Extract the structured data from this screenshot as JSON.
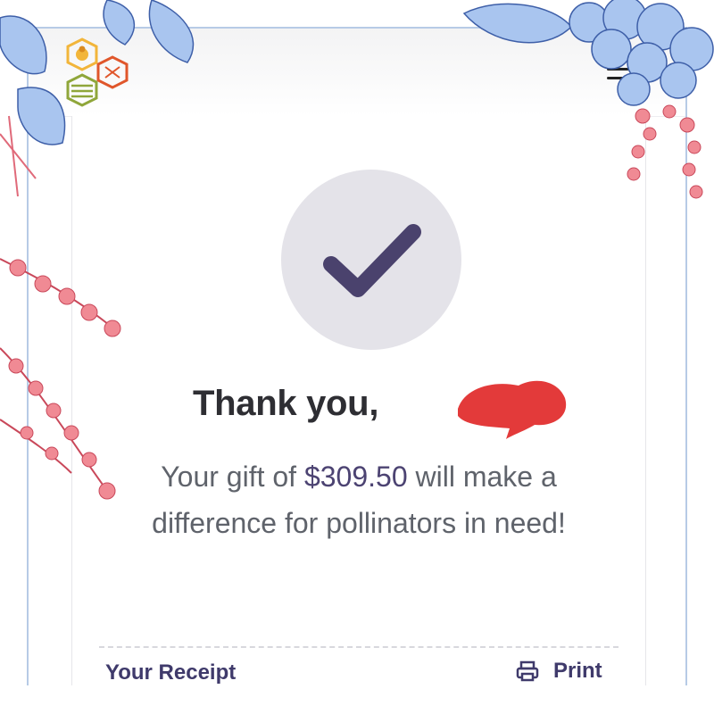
{
  "header": {
    "logo_icon": "honeycomb-bee-logo-icon",
    "menu_icon": "hamburger-menu-icon"
  },
  "confirmation": {
    "icon": "checkmark-icon",
    "title_prefix": "Thank you,",
    "title_suffix": "!",
    "message_before": "Your gift of",
    "amount": "$309.50",
    "message_after": "will make a difference for pollinators in need!"
  },
  "receipt": {
    "label": "Your Receipt",
    "print_label": "Print",
    "print_icon": "printer-icon"
  },
  "colors": {
    "accent": "#4c4372",
    "check_bg": "#e4e3e9",
    "frame": "#b7cbe6",
    "redaction": "#e33a3a",
    "blue_flowers": "#a9c5ef",
    "pink_flowers": "#f08a94"
  }
}
